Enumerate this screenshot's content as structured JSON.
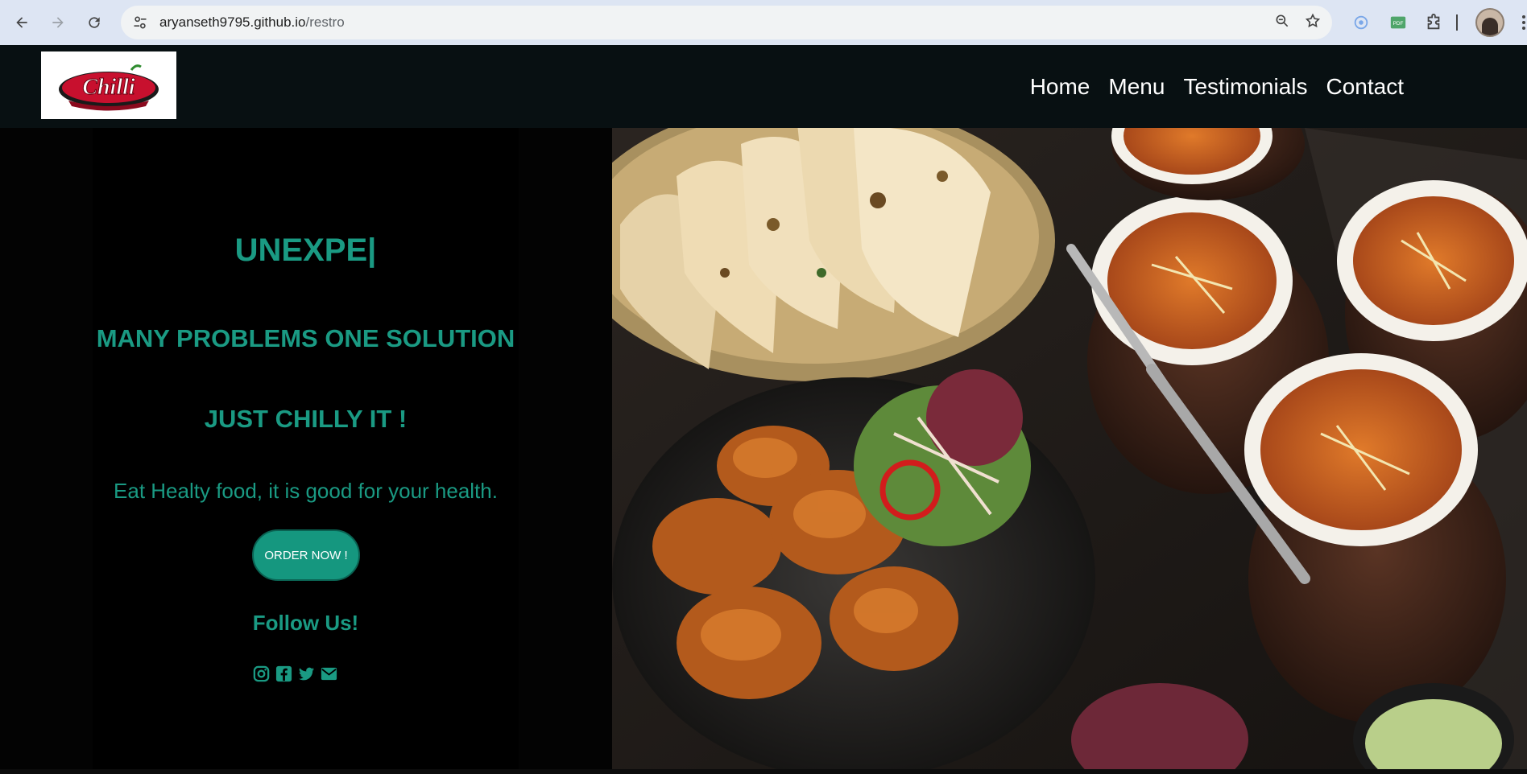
{
  "browser": {
    "url_host": "aryanseth9795.github.io",
    "url_path": "/restro"
  },
  "site": {
    "logo_text": "Chilli",
    "nav": [
      "Home",
      "Menu",
      "Testimonials",
      "Contact"
    ]
  },
  "hero": {
    "typed_text": "UNEXPE|",
    "line2": "MANY PROBLEMS ONE SOLUTION",
    "line3": "JUST CHILLY IT !",
    "tagline": "Eat Healty food, it is good for your health.",
    "order_button": "ORDER NOW !",
    "follow": "Follow Us!",
    "social_icons": [
      "instagram-icon",
      "facebook-icon",
      "twitter-icon",
      "mail-icon"
    ]
  },
  "colors": {
    "accent": "#1a9a83",
    "header_bg": "#081012",
    "button_bg": "#15977f"
  }
}
